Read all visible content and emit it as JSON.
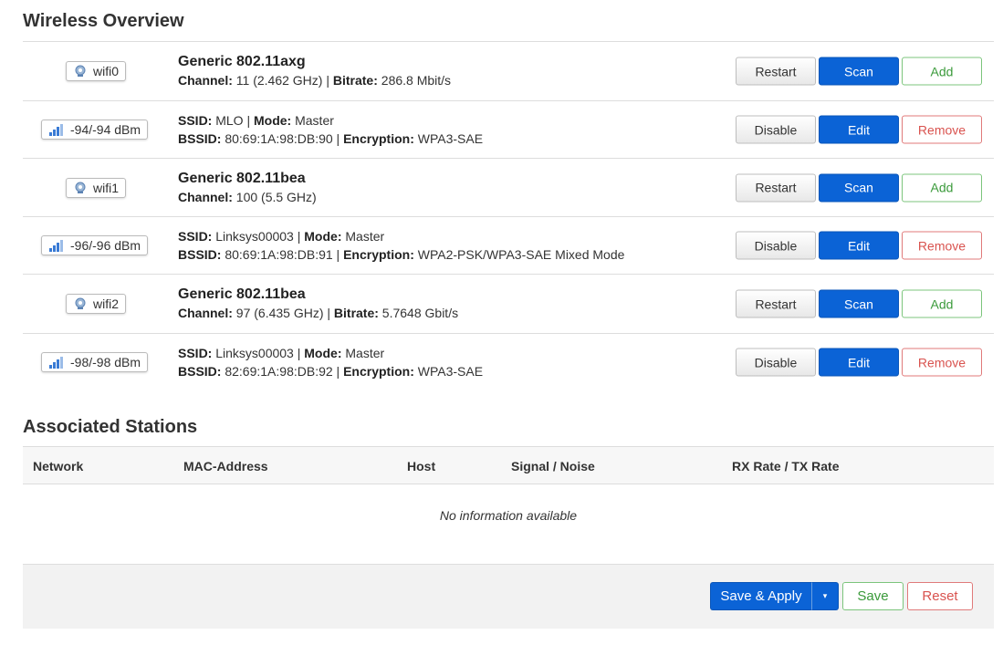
{
  "wireless_overview": {
    "title": "Wireless Overview",
    "rows": [
      {
        "kind": "radio",
        "badge": "wifi0",
        "title": "Generic 802.11axg",
        "line1": {
          "k1": "Channel:",
          "v1": " 11 (2.462 GHz) | ",
          "k2": "Bitrate:",
          "v2": " 286.8 Mbit/s"
        },
        "buttons": [
          "Restart",
          "Scan",
          "Add"
        ]
      },
      {
        "kind": "net",
        "badge": "-94/-94 dBm",
        "line1": {
          "k1": "SSID:",
          "v1": " MLO | ",
          "k2": "Mode:",
          "v2": " Master"
        },
        "line2": {
          "k1": "BSSID:",
          "v1": " 80:69:1A:98:DB:90 | ",
          "k2": "Encryption:",
          "v2": " WPA3-SAE"
        },
        "buttons": [
          "Disable",
          "Edit",
          "Remove"
        ]
      },
      {
        "kind": "radio",
        "badge": "wifi1",
        "title": "Generic 802.11bea",
        "line1": {
          "k1": "Channel:",
          "v1": " 100 (5.5 GHz)",
          "k2": "",
          "v2": ""
        },
        "buttons": [
          "Restart",
          "Scan",
          "Add"
        ]
      },
      {
        "kind": "net",
        "badge": "-96/-96 dBm",
        "line1": {
          "k1": "SSID:",
          "v1": " Linksys00003 | ",
          "k2": "Mode:",
          "v2": " Master"
        },
        "line2": {
          "k1": "BSSID:",
          "v1": " 80:69:1A:98:DB:91 | ",
          "k2": "Encryption:",
          "v2": " WPA2-PSK/WPA3-SAE Mixed Mode"
        },
        "buttons": [
          "Disable",
          "Edit",
          "Remove"
        ]
      },
      {
        "kind": "radio",
        "badge": "wifi2",
        "title": "Generic 802.11bea",
        "line1": {
          "k1": "Channel:",
          "v1": " 97 (6.435 GHz) | ",
          "k2": "Bitrate:",
          "v2": " 5.7648 Gbit/s"
        },
        "buttons": [
          "Restart",
          "Scan",
          "Add"
        ]
      },
      {
        "kind": "net",
        "badge": "-98/-98 dBm",
        "line1": {
          "k1": "SSID:",
          "v1": " Linksys00003 | ",
          "k2": "Mode:",
          "v2": " Master"
        },
        "line2": {
          "k1": "BSSID:",
          "v1": " 82:69:1A:98:DB:92 | ",
          "k2": "Encryption:",
          "v2": " WPA3-SAE"
        },
        "buttons": [
          "Disable",
          "Edit",
          "Remove"
        ]
      }
    ]
  },
  "associated_stations": {
    "title": "Associated Stations",
    "columns": [
      "Network",
      "MAC-Address",
      "Host",
      "Signal / Noise",
      "RX Rate / TX Rate"
    ],
    "empty_text": "No information available"
  },
  "footer": {
    "save_apply": "Save & Apply",
    "dropdown_glyph": "▾",
    "save": "Save",
    "reset": "Reset"
  },
  "colors": {
    "primary": "#0b63d6",
    "positive": "#3a9a3a",
    "negative": "#d9534f"
  },
  "icons": {
    "radio": "wifi-radio-icon",
    "signal": "signal-bars-icon"
  }
}
